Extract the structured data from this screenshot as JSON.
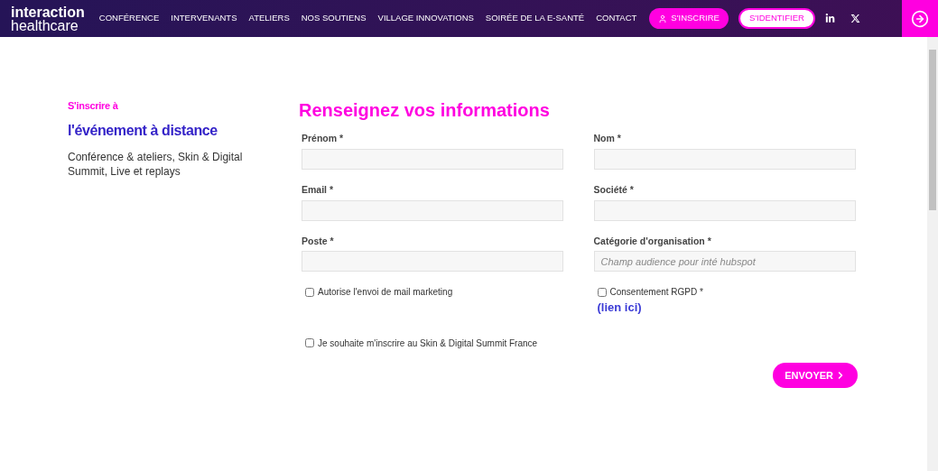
{
  "brand": {
    "line_1": "interaction",
    "line_2": "healthcare"
  },
  "nav": [
    "CONFÉRENCE",
    "INTERVENANTS",
    "ATELIERS",
    "NOS SOUTIENS",
    "VILLAGE INNOVATIONS",
    "SOIRÉE DE LA E-SANTÉ",
    "CONTACT"
  ],
  "register_button": "S'INSCRIRE",
  "login_button": "S'IDENTIFIER",
  "intro": {
    "kicker": "S'inscrire à",
    "title": "l'événement à distance",
    "description": "Conférence & ateliers, Skin & Digital Summit, Live et replays"
  },
  "form": {
    "title": "Renseignez vos informations",
    "fields": [
      {
        "label": "Prénom *"
      },
      {
        "label": "Nom *"
      },
      {
        "label": "Email *"
      },
      {
        "label": "Société *"
      },
      {
        "label": "Poste *"
      },
      {
        "label": "Catégorie d'organisation *",
        "placeholder": "Champ audience pour inté hubspot"
      }
    ],
    "checkboxes": [
      {
        "label": "Autorise l'envoi de mail marketing",
        "checked": false
      },
      {
        "label": "Consentement RGPD *",
        "checked": false,
        "link": "(lien ici)"
      },
      {
        "label": "Je souhaite m'inscrire au Skin & Digital Summit France",
        "checked": false
      }
    ],
    "submit": "ENVOYER"
  }
}
